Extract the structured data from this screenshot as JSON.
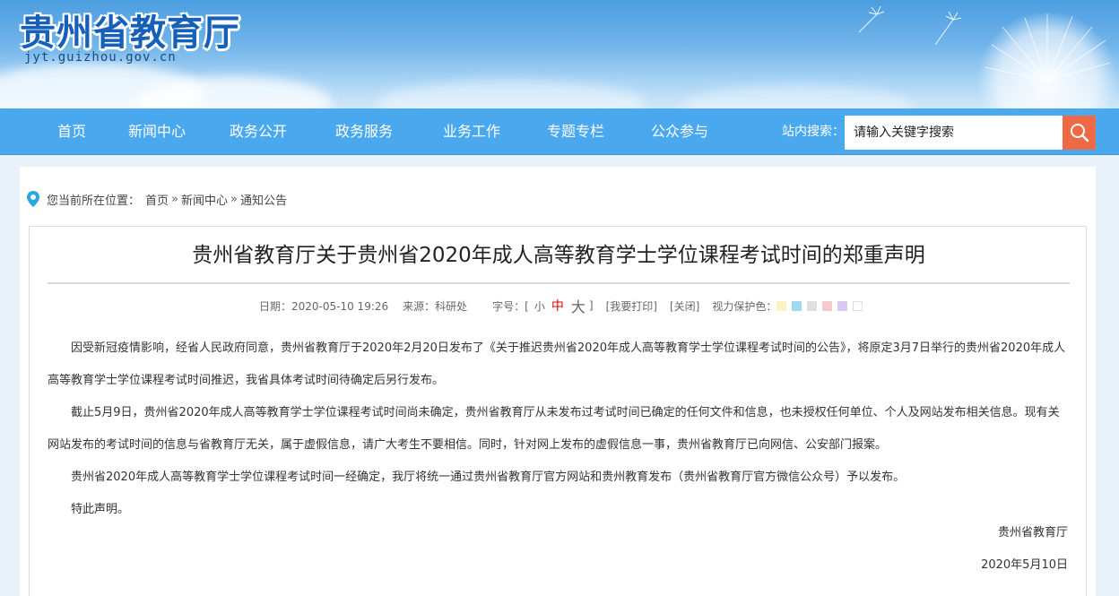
{
  "header": {
    "site_title": "贵州省教育厅",
    "site_domain": "jyt.guizhou.gov.cn"
  },
  "nav": {
    "items": [
      {
        "label": "首页"
      },
      {
        "label": "新闻中心"
      },
      {
        "label": "政务公开"
      },
      {
        "label": "政务服务"
      },
      {
        "label": "业务工作"
      },
      {
        "label": "专题专栏"
      },
      {
        "label": "公众参与"
      }
    ],
    "search_label": "站内搜索：",
    "search_placeholder": "请输入关键字搜索",
    "search_icon": "search-icon"
  },
  "breadcrumb": {
    "prefix": "您当前所在位置：",
    "items": [
      "首页",
      "新闻中心",
      "通知公告"
    ],
    "separator": "»"
  },
  "article": {
    "title": "贵州省教育厅关于贵州省2020年成人高等教育学士学位课程考试时间的郑重声明",
    "date": "日期：2020-05-10 19:26",
    "source": "来源：科研处",
    "font_size_label": "字号：[",
    "font_small": "小",
    "font_medium": "中",
    "font_large": "大",
    "font_close": "]",
    "print": "[我要打印]",
    "close": "[关闭]",
    "eye_care_label": "视力保护色：",
    "eye_care_colors": [
      "#faf4c0",
      "#9fdcf0",
      "#dfdfdf",
      "#f5c9cf",
      "#d9c9f3",
      "#ffffff"
    ],
    "paragraphs": [
      "因受新冠疫情影响，经省人民政府同意，贵州省教育厅于2020年2月20日发布了《关于推迟贵州省2020年成人高等教育学士学位课程考试时间的公告》，将原定3月7日举行的贵州省2020年成人高等教育学士学位课程考试时间推迟，我省具体考试时间待确定后另行发布。",
      "截止5月9日，贵州省2020年成人高等教育学士学位课程考试时间尚未确定，贵州省教育厅从未发布过考试时间已确定的任何文件和信息，也未授权任何单位、个人及网站发布相关信息。现有关网站发布的考试时间的信息与省教育厅无关，属于虚假信息，请广大考生不要相信。同时，针对网上发布的虚假信息一事，贵州省教育厅已向网信、公安部门报案。",
      "贵州省2020年成人高等教育学士学位课程考试时间一经确定，我厅将统一通过贵州省教育厅官方网站和贵州教育发布（贵州省教育厅官方微信公众号）予以发布。",
      "特此声明。"
    ],
    "signature": "贵州省教育厅",
    "sign_date": "2020年5月10日"
  }
}
